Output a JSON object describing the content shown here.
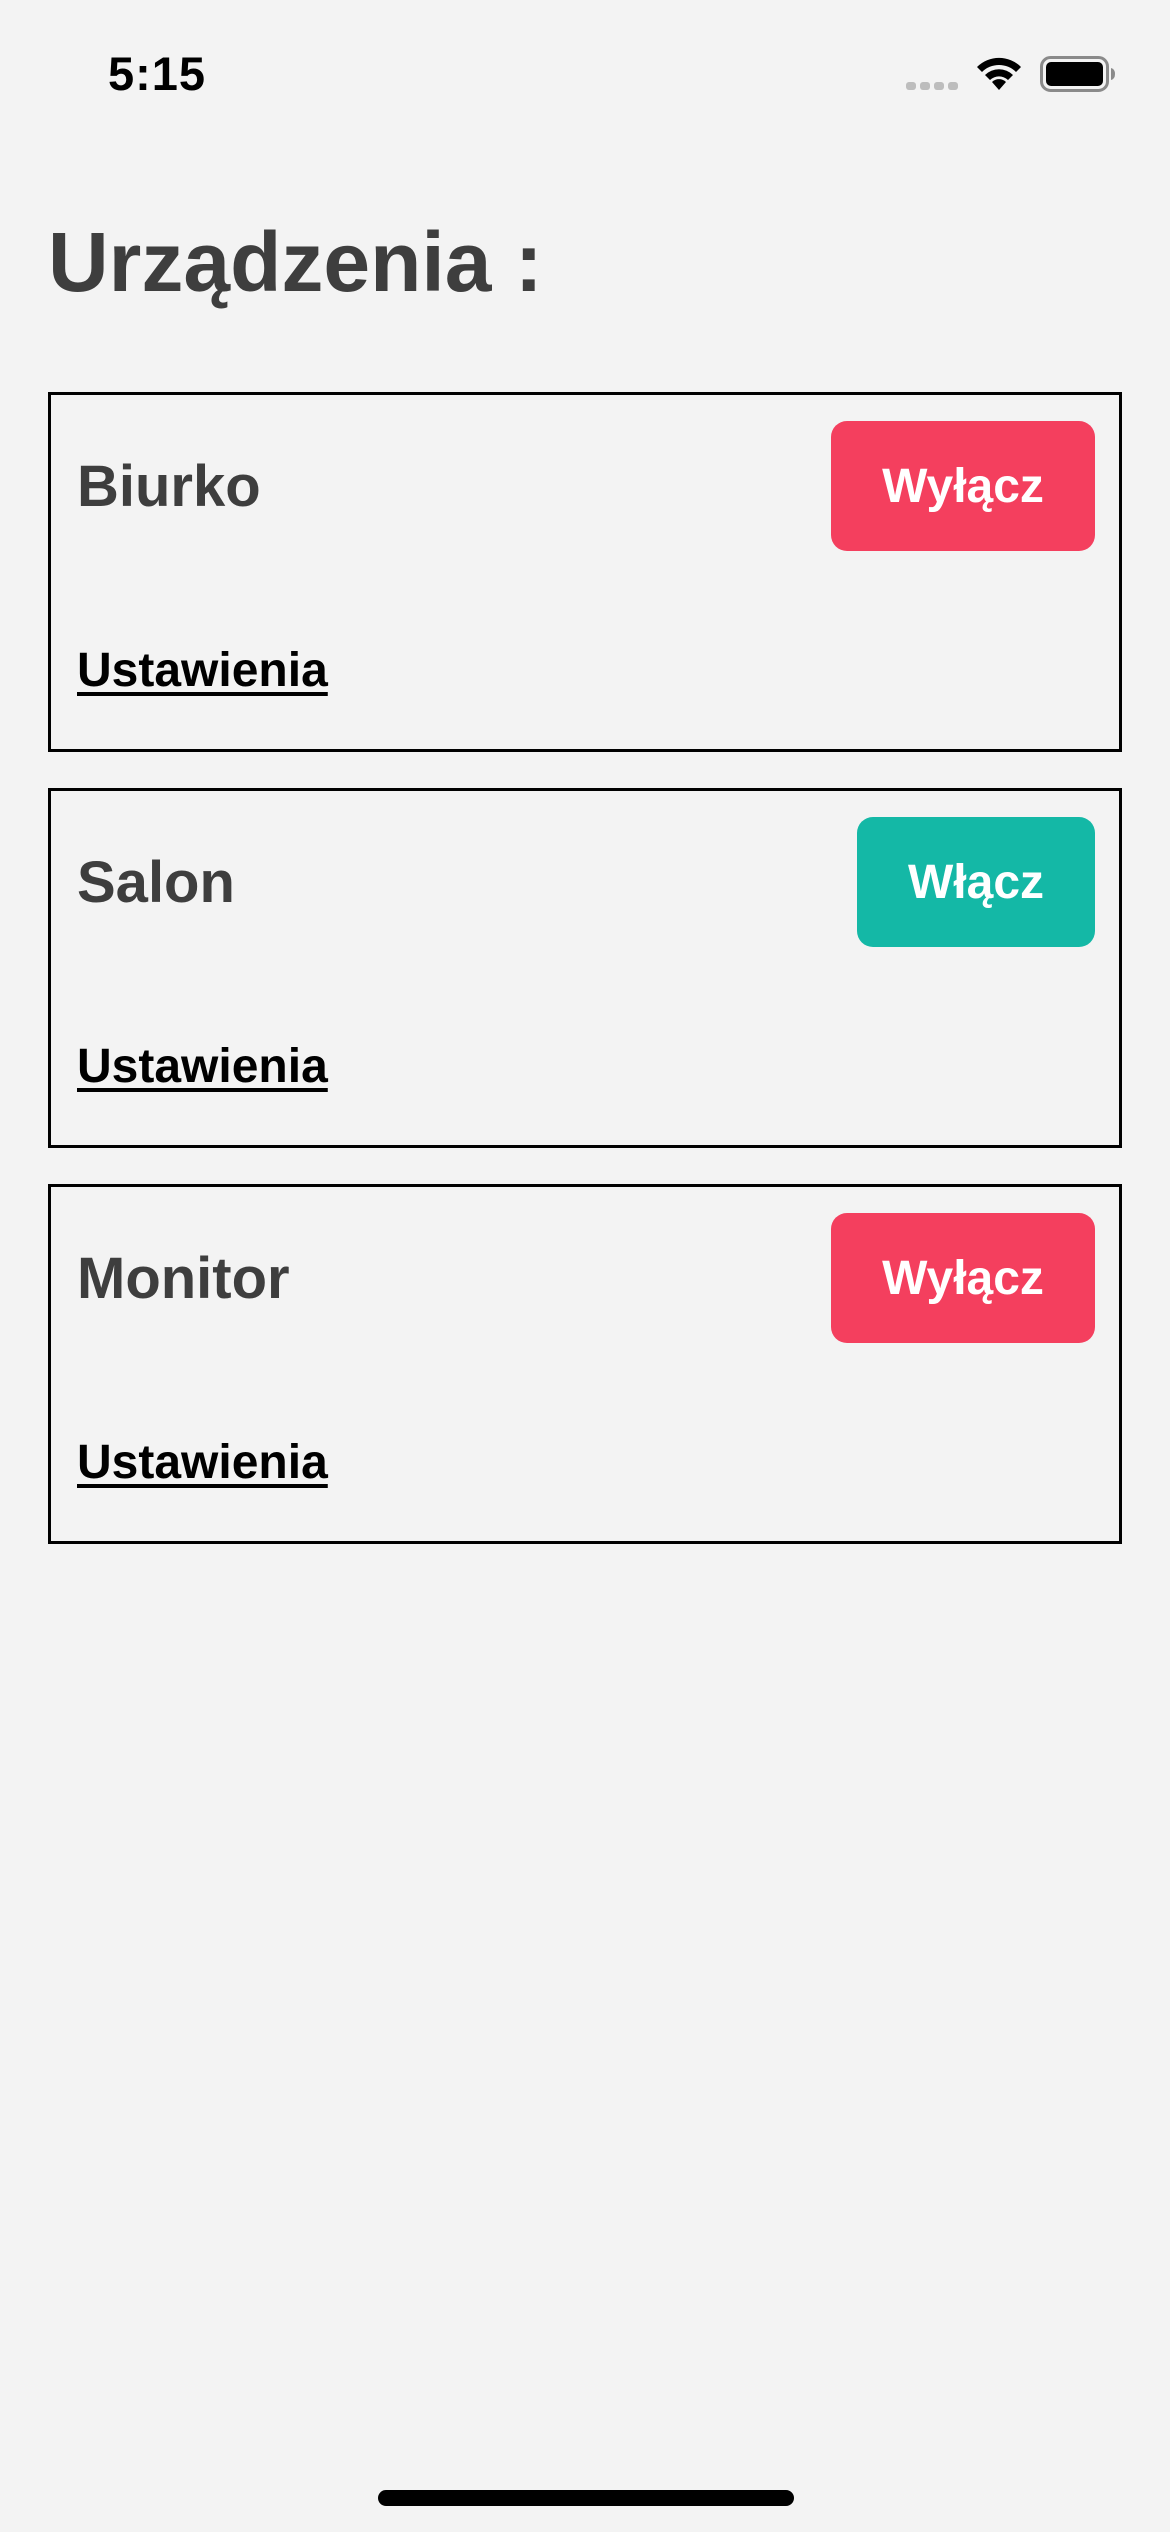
{
  "status_bar": {
    "time": "5:15",
    "icons": [
      "signal-icon",
      "wifi-icon",
      "battery-icon"
    ]
  },
  "page": {
    "title": "Urządzenia :"
  },
  "colors": {
    "background": "#f3f3f3",
    "off_button": "#f43f5e",
    "on_button": "#14b8a6",
    "title_text": "#3e3e3e"
  },
  "devices": [
    {
      "name": "Biurko",
      "button_label": "Wyłącz",
      "settings_label": "Ustawienia"
    },
    {
      "name": "Salon",
      "button_label": "Włącz",
      "settings_label": "Ustawienia"
    },
    {
      "name": "Monitor",
      "button_label": "Wyłącz",
      "settings_label": "Ustawienia"
    }
  ]
}
